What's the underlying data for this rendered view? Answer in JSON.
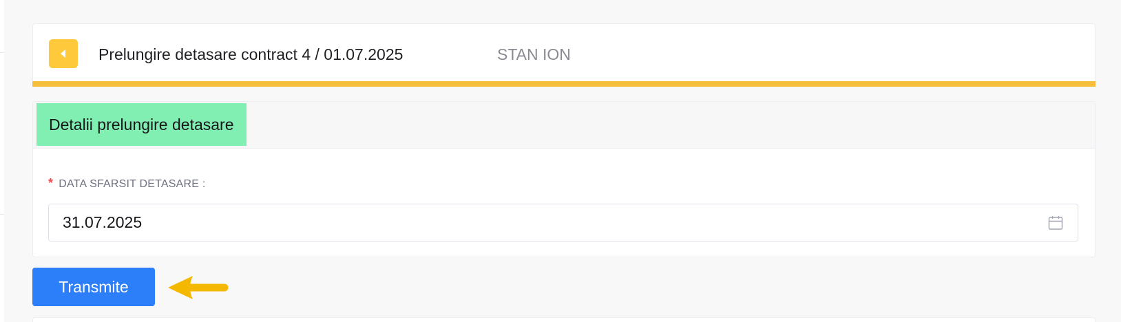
{
  "header": {
    "back_icon": "chevron-left-icon",
    "title": "Prelungire detasare contract 4 / 01.07.2025",
    "subtitle": "STAN ION",
    "colors": {
      "back_button": "#ffc93c",
      "accent_bar": "#f6be3b",
      "subtitle": "#8a8a92"
    }
  },
  "details": {
    "section_title": "Detalii prelungire detasare",
    "section_color": "#81efb2",
    "field": {
      "required_marker": "*",
      "label": "DATA SFARSIT DETASARE :",
      "value": "31.07.2025",
      "icon": "calendar-icon"
    }
  },
  "actions": {
    "submit_label": "Transmite",
    "submit_color": "#2d7ff9",
    "annotation_icon": "arrow-left-icon",
    "annotation_color": "#f5b800"
  }
}
